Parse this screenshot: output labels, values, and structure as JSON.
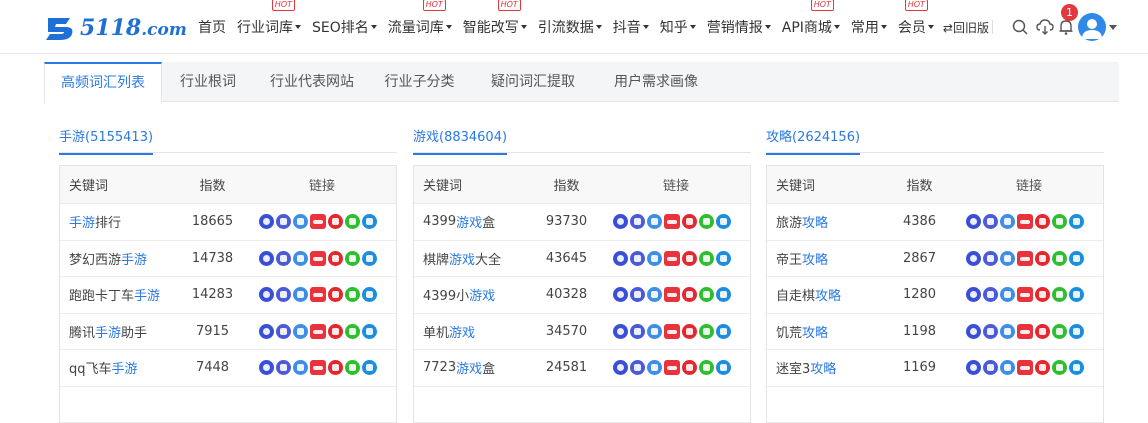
{
  "logo": {
    "main": "5118",
    "suffix": ".com"
  },
  "nav": [
    {
      "label": "首页",
      "caret": false,
      "hot": false
    },
    {
      "label": "行业词库",
      "caret": true,
      "hot": true
    },
    {
      "label": "SEO排名",
      "caret": true,
      "hot": false
    },
    {
      "label": "流量词库",
      "caret": true,
      "hot": true
    },
    {
      "label": "智能改写",
      "caret": true,
      "hot": true
    },
    {
      "label": "引流数据",
      "caret": true,
      "hot": false
    },
    {
      "label": "抖音",
      "caret": true,
      "hot": false
    },
    {
      "label": "知乎",
      "caret": true,
      "hot": false
    },
    {
      "label": "营销情报",
      "caret": true,
      "hot": false
    },
    {
      "label": "API商城",
      "caret": true,
      "hot": true
    },
    {
      "label": "常用",
      "caret": true,
      "hot": false
    },
    {
      "label": "会员",
      "caret": true,
      "hot": true
    }
  ],
  "hot_label": "HOT",
  "old_version": "⇄回旧版",
  "notification_count": "1",
  "tabs": [
    "高频词汇列表",
    "行业根词",
    "行业代表网站",
    "行业子分类",
    "疑问词汇提取",
    "用户需求画像"
  ],
  "active_tab": 0,
  "table_headers": {
    "keyword": "关键词",
    "index": "指数",
    "links": "链接"
  },
  "link_icons": [
    "baidu-icon",
    "sogou-icon",
    "360-icon",
    "toutiao-icon",
    "weibo-icon",
    "weixin-icon",
    "zhihu-icon"
  ],
  "colors": {
    "accent": "#2a7ae2",
    "hot": "#e2393f"
  },
  "panels": [
    {
      "title": "手游(5155413)",
      "rows": [
        {
          "pre": "",
          "hl": "手游",
          "post": "排行",
          "index": "18665"
        },
        {
          "pre": "梦幻西游",
          "hl": "手游",
          "post": "",
          "index": "14738"
        },
        {
          "pre": "跑跑卡丁车",
          "hl": "手游",
          "post": "",
          "index": "14283"
        },
        {
          "pre": "腾讯",
          "hl": "手游",
          "post": "助手",
          "index": "7915"
        },
        {
          "pre": "qq飞车",
          "hl": "手游",
          "post": "",
          "index": "7448"
        }
      ]
    },
    {
      "title": "游戏(8834604)",
      "rows": [
        {
          "pre": "4399",
          "hl": "游戏",
          "post": "盒",
          "index": "93730"
        },
        {
          "pre": "棋牌",
          "hl": "游戏",
          "post": "大全",
          "index": "43645"
        },
        {
          "pre": "4399小",
          "hl": "游戏",
          "post": "",
          "index": "40328"
        },
        {
          "pre": "单机",
          "hl": "游戏",
          "post": "",
          "index": "34570"
        },
        {
          "pre": "7723",
          "hl": "游戏",
          "post": "盒",
          "index": "24581"
        }
      ]
    },
    {
      "title": "攻略(2624156)",
      "rows": [
        {
          "pre": "旅游",
          "hl": "攻略",
          "post": "",
          "index": "4386"
        },
        {
          "pre": "帝王",
          "hl": "攻略",
          "post": "",
          "index": "2867"
        },
        {
          "pre": "自走棋",
          "hl": "攻略",
          "post": "",
          "index": "1280"
        },
        {
          "pre": "饥荒",
          "hl": "攻略",
          "post": "",
          "index": "1198"
        },
        {
          "pre": "迷室3",
          "hl": "攻略",
          "post": "",
          "index": "1169"
        }
      ]
    }
  ]
}
